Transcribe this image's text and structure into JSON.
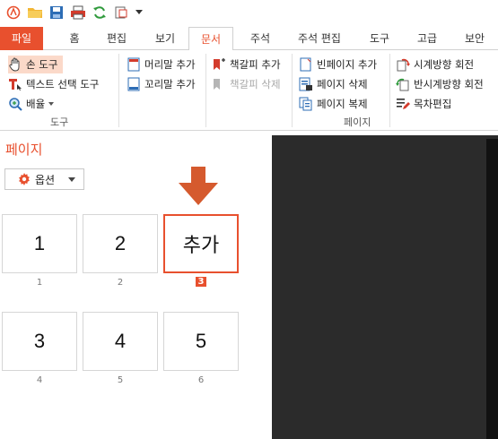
{
  "quick_access": {
    "icons": [
      "app-logo-icon",
      "open-folder-icon",
      "save-icon",
      "print-icon",
      "refresh-icon",
      "page-icon",
      "dropdown-icon"
    ]
  },
  "menu": {
    "tabs": [
      {
        "label": "파일"
      },
      {
        "label": "홈"
      },
      {
        "label": "편집"
      },
      {
        "label": "보기"
      },
      {
        "label": "문서"
      },
      {
        "label": "주석"
      },
      {
        "label": "주석 편집"
      },
      {
        "label": "도구"
      },
      {
        "label": "고급"
      },
      {
        "label": "보안"
      }
    ],
    "active": "문서"
  },
  "ribbon": {
    "tools": {
      "hand": "손 도구",
      "text_select": "텍스트 선택 도구",
      "zoom": "배율",
      "group_label": "도구"
    },
    "header_footer": {
      "header": "머리말 추가",
      "footer": "꼬리말 추가"
    },
    "bookmark": {
      "add": "책갈피 추가",
      "delete": "책갈피 삭제"
    },
    "pages": {
      "blank": "빈페이지 추가",
      "delete": "페이지 삭제",
      "duplicate": "페이지 복제",
      "group_label": "페이지"
    },
    "rotate": {
      "cw": "시계방향 회전",
      "ccw": "반시계방향 회전",
      "toc": "목차편집"
    }
  },
  "panel": {
    "title": "페이지",
    "options_label": "옵션",
    "thumbnails": [
      {
        "content": "1",
        "number": "1"
      },
      {
        "content": "2",
        "number": "2"
      },
      {
        "content": "추가",
        "number": "3"
      },
      {
        "content": "3",
        "number": "4"
      },
      {
        "content": "4",
        "number": "5"
      },
      {
        "content": "5",
        "number": "6"
      }
    ]
  },
  "colors": {
    "accent": "#e8502e",
    "selected_bg": "#fbd9c9",
    "document_bg": "#2b2b2b"
  }
}
